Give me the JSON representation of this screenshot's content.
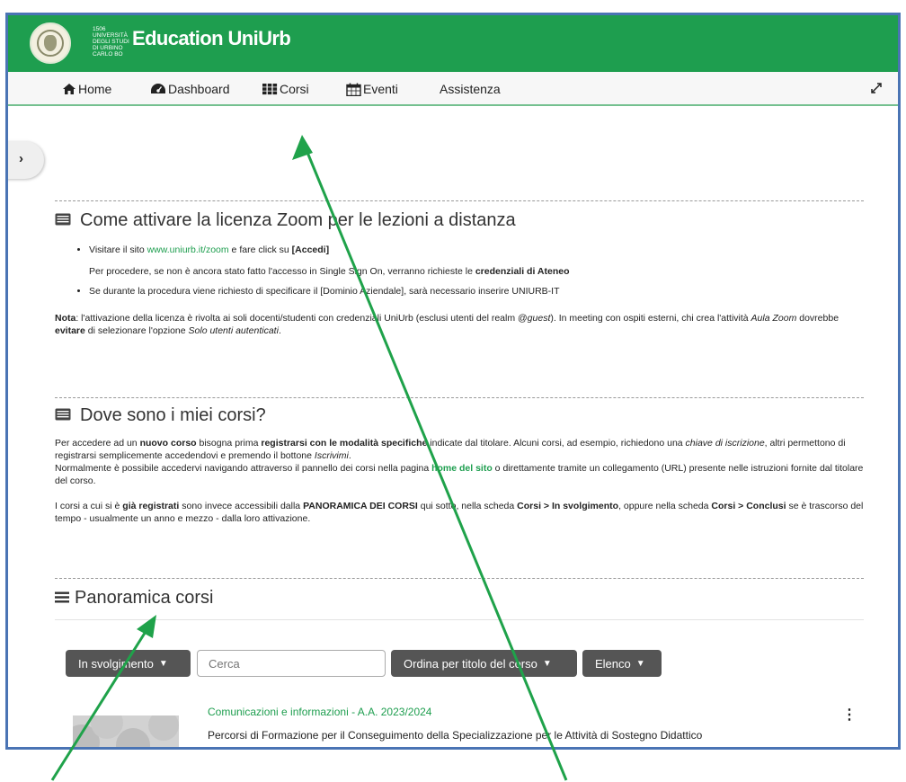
{
  "header": {
    "uni_year": "1506",
    "uni_lines": [
      "UNIVERSITÀ",
      "DEGLI STUDI",
      "DI URBINO",
      "CARLO BO"
    ],
    "site_title": "Education UniUrb"
  },
  "nav": {
    "items": [
      {
        "label": "Home",
        "icon": "home-icon"
      },
      {
        "label": "Dashboard",
        "icon": "tachometer-icon"
      },
      {
        "label": "Corsi",
        "icon": "grid-icon"
      },
      {
        "label": "Eventi",
        "icon": "calendar-icon"
      },
      {
        "label": "Assistenza",
        "icon": ""
      }
    ],
    "expand_icon": "expand-icon"
  },
  "drawer": {
    "toggle_glyph": "›"
  },
  "zoom_section": {
    "title": "Come attivare la licenza Zoom per le lezioni a distanza",
    "bullet1_pre": "Visitare il sito ",
    "bullet1_link": "www.uniurb.it/zoom",
    "bullet1_mid": " e fare click su ",
    "bullet1_bold": "[Accedi]",
    "sub_pre": "Per procedere, se non è ancora stato fatto l'accesso in Single Sign On, verranno richieste le ",
    "sub_bold": "credenziali di Ateneo",
    "bullet2": "Se durante la procedura viene richiesto di specificare il [Dominio Aziendale], sarà necessario inserire UNIURB-IT",
    "nota_label": "Nota",
    "nota_1": ": l'attivazione della licenza è rivolta ai soli docenti/studenti con credenziali UniUrb (esclusi utenti del realm @",
    "nota_guest": "guest",
    "nota_2": "). In meeting con ospiti esterni, chi crea l'attività ",
    "nota_aula": "Aula Zoom",
    "nota_3": " dovrebbe ",
    "nota_evitare": "evitare",
    "nota_4": " di selezionare l'opzione ",
    "nota_solo": "Solo utenti autenticati",
    "nota_5": "."
  },
  "corsi_section": {
    "title": "Dove sono i miei corsi?",
    "p1_a": "Per accedere ad un ",
    "p1_b": "nuovo corso",
    "p1_c": " bisogna prima ",
    "p1_d": "registrarsi con le modalità specifiche",
    "p1_e": " indicate dal titolare. Alcuni corsi, ad esempio, richiedono una ",
    "p1_f": "chiave di iscrizione",
    "p1_g": ", altri permettono di registrarsi semplicemente accedendovi e premendo il bottone ",
    "p1_h": "Iscrivimi",
    "p1_i": ".",
    "p2_a": "Normalmente è possibile accedervi navigando attraverso il pannello dei corsi nella pagina ",
    "p2_link": "home del sito",
    "p2_b": " o direttamente tramite un collegamento (URL) presente nelle istruzioni fornite dal titolare del corso.",
    "p3_a": "I corsi a cui si è ",
    "p3_b": "già registrati",
    "p3_c": " sono invece accessibili dalla ",
    "p3_d": "PANORAMICA DEI CORSI",
    "p3_e": " qui sotto, nella scheda ",
    "p3_f": "Corsi > In svolgimento",
    "p3_g": ", oppure nella scheda ",
    "p3_h": "Corsi > Conclusi",
    "p3_i": " se è trascorso del tempo - usualmente un anno e mezzo - dalla loro attivazione."
  },
  "overview": {
    "title": "Panoramica corsi",
    "filter_label": "In svolgimento",
    "search_placeholder": "Cerca",
    "sort_label": "Ordina per titolo del corso",
    "view_label": "Elenco",
    "course": {
      "category": "Comunicazioni e informazioni - A.A. 2023/2024",
      "name": "Percorsi di Formazione per il Conseguimento della Specializzazione per le Attività di Sostegno Didattico",
      "menu_glyph": "⋮"
    }
  },
  "colors": {
    "brand_green": "#1e9e4f",
    "arrow_green": "#1fa24a",
    "dark_button": "#555555",
    "frame_border": "#4a74b4"
  }
}
